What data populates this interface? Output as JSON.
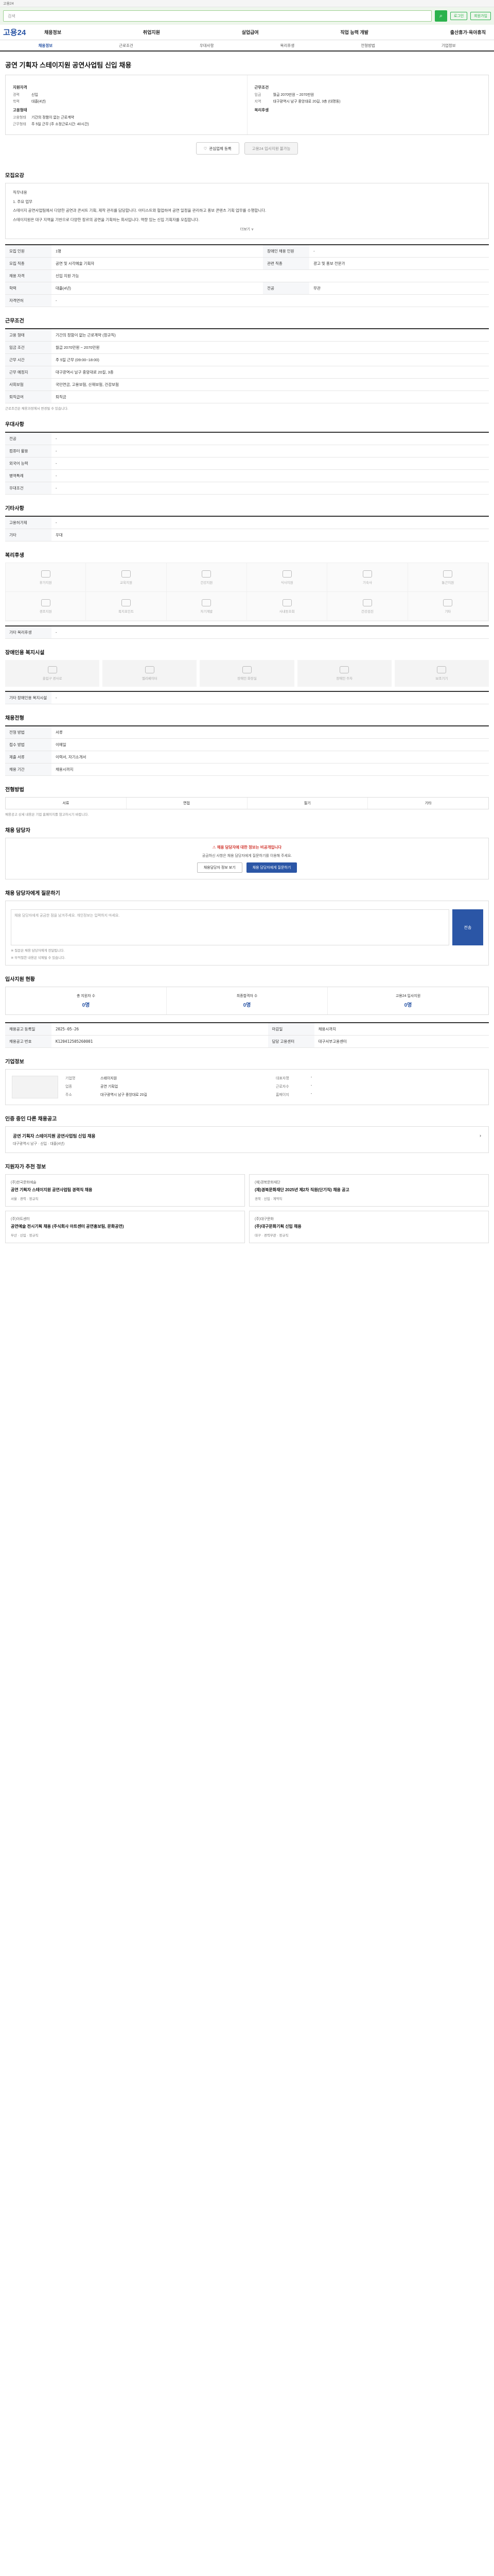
{
  "top": {
    "notice": "고용24",
    "search_placeholder": "검색",
    "login": "로그인",
    "join": "회원가입"
  },
  "gnb": {
    "logo": "고용24",
    "menu": [
      "채용정보",
      "취업지원",
      "실업급여",
      "직업 능력 개발",
      "출산휴가·육아휴직"
    ]
  },
  "tabs": [
    "채용정보",
    "근로조건",
    "우대사항",
    "복리후생",
    "전형방법",
    "기업정보"
  ],
  "job": {
    "title": "공연 기획자 스테이지원 공연사업팀 신입 채용",
    "summary_left_label": "지원자격",
    "summary_right_label": "근무조건",
    "career_k": "경력",
    "career_v": "신입",
    "edu_k": "학력",
    "edu_v": "대졸(4년)",
    "emp_label": "고용형태",
    "emp_k": "고용형태",
    "emp_v": "기간의 정함이 없는 근로계약",
    "hours_k": "근무형태",
    "hours_v": "주 5일 근무 (주 소정근로시간: 40시간)",
    "pay_k": "임금",
    "pay_v": "월급 2070만원 ~ 2070만원",
    "area_k": "지역",
    "area_v": "대구광역시 남구 중앙대로 20길, 3층 (대명동)",
    "welfare_label": "복리후생"
  },
  "buttons": {
    "interest": "관심업체 등록",
    "apply": "고용24 입사지원 불가능"
  },
  "sections": {
    "recruit": "모집요강",
    "conditions": "근무조건",
    "preference": "우대사항",
    "extra": "기타사항",
    "welfare": "복리후생",
    "facility": "장애인용 복지시설",
    "process": "채용전형",
    "apply_method": "전형방법",
    "contact": "채용 담당자",
    "qa": "채용 담당자에게 질문하기",
    "status": "입사지원 현황",
    "company": "기업정보",
    "same_company": "인증 중인 다른 채용공고",
    "recommend": "지원자가 추천 정보"
  },
  "recruit_box": {
    "p1": "직무내용",
    "p2": "1. 주요 업무",
    "p3": "스테이지 공연사업팀에서 다양한 공연과 콘서트 기획, 제작 관리를 담당합니다. 아티스트와 협업하여 공연 일정을 관리하고 홍보 콘텐츠 기획 업무를 수행합니다.",
    "p4": "스테이지원은 대구 지역을 기반으로 다양한 장르의 공연을 기획하는 회사입니다. 역량 있는 신입 기획자를 모집합니다.",
    "more": "더보기 ∨"
  },
  "recruit_table": [
    {
      "k": "모집 인원",
      "v": "1명",
      "k2": "장애인 채용 인원",
      "v2": "-"
    },
    {
      "k": "모집 직종",
      "v": "공연 및 시각예술 기획자",
      "k2": "관련 직종",
      "v2": "광고 및 홍보 전문가"
    },
    {
      "k": "채용 자격",
      "v": "신입 지원 가능",
      "k2": "",
      "v2": ""
    },
    {
      "k": "학력",
      "v": "대졸(4년)",
      "k2": "전공",
      "v2": "무관"
    },
    {
      "k": "자격면허",
      "v": "-",
      "k2": "",
      "v2": ""
    }
  ],
  "cond_table": [
    {
      "k": "고용 형태",
      "v": "기간의 정함이 없는 근로계약 (정규직)"
    },
    {
      "k": "임금 조건",
      "v": "월급 2070만원 ~ 2070만원"
    },
    {
      "k": "근무 시간",
      "v": "주 5일 근무 (09:00~18:00)"
    },
    {
      "k": "근무 예정지",
      "v": "대구광역시 남구 중앙대로 20길, 3층"
    },
    {
      "k": "사회보험",
      "v": "국민연금, 고용보험, 산재보험, 건강보험"
    },
    {
      "k": "퇴직급여",
      "v": "퇴직금"
    }
  ],
  "cond_note": "근로조건은 채용과정에서 변경될 수 있습니다.",
  "pref_table": [
    {
      "k": "전공",
      "v": "-"
    },
    {
      "k": "컴퓨터 활용",
      "v": "-"
    },
    {
      "k": "외국어 능력",
      "v": "-"
    },
    {
      "k": "병역특례",
      "v": "-"
    },
    {
      "k": "우대조건",
      "v": "-"
    }
  ],
  "extra_table": [
    {
      "k": "고용허가제",
      "v": "-"
    },
    {
      "k": "기타",
      "v": "우대"
    }
  ],
  "welfare_items": [
    "휴가지원",
    "교육지원",
    "건강지원",
    "식사지원",
    "기숙사",
    "통근지원",
    "경조지원",
    "복지포인트",
    "자기계발",
    "사내동호회",
    "건강검진",
    "기타"
  ],
  "welfare_note": "기타 복리후생",
  "facility_items": [
    "출입구 경사로",
    "엘리베이터",
    "장애인 화장실",
    "장애인 주차",
    "보조기기"
  ],
  "facility_note": "기타 장애인용 복지시설",
  "process_table": [
    {
      "k": "전형 방법",
      "v": "서류"
    },
    {
      "k": "접수 방법",
      "v": "이메일"
    },
    {
      "k": "제출 서류",
      "v": "이력서, 자기소개서"
    },
    {
      "k": "채용 기간",
      "v": "채용시까지"
    }
  ],
  "apply_methods": [
    "서류",
    "면접",
    "필기",
    "기타"
  ],
  "apply_note": "채용공고 상세 내용은 기업 홈페이지를 참고하시기 바랍니다.",
  "contact": {
    "warn": "채용 담당자에 대한 정보는 비공개입니다",
    "sub": "궁금하신 사항은 채용 담당자에게 질문하기를 이용해 주세요.",
    "btn1": "채용담당자 정보 보기",
    "btn2": "채용 담당자에게 질문하기"
  },
  "qa": {
    "placeholder": "채용 담당자에게 궁금한 점을 남겨주세요. 개인정보는 입력하지 마세요.",
    "send": "전송",
    "note1": "※ 질문은 채용 담당자에게 전달됩니다.",
    "note2": "※ 부적절한 내용은 삭제될 수 있습니다."
  },
  "status": [
    {
      "label": "총 지원자 수",
      "num": "0명"
    },
    {
      "label": "최종합격자 수",
      "num": "0명"
    },
    {
      "label": "고용24 입사지원",
      "num": "0명"
    }
  ],
  "dates": [
    {
      "k": "채용공고 등록일",
      "v": "2025-05-26",
      "k2": "마감일",
      "v2": "채용시까지"
    },
    {
      "k": "채용공고 번호",
      "v": "K120412505260001",
      "k2": "담당 고용센터",
      "v2": "대구서부고용센터"
    }
  ],
  "company": {
    "name_k": "기업명",
    "name_v": "스테이지원",
    "ceo_k": "대표자명",
    "ceo_v": "-",
    "industry_k": "업종",
    "industry_v": "공연 기획업",
    "size_k": "근로자수",
    "size_v": "-",
    "addr_k": "주소",
    "addr_v": "대구광역시 남구 중앙대로 20길",
    "home_k": "홈페이지",
    "home_v": "-"
  },
  "same_job": {
    "title": "공연 기획자 스테이지원 공연사업팀 신입 채용",
    "sub": "대구광역시 남구 · 신입 · 대졸(4년)"
  },
  "recs": [
    {
      "company": "(주)한국문화예술",
      "title": "공연 기획자 스테이지원 공연사업팀 경력직 채용",
      "meta": "서울 · 경력 · 정규직"
    },
    {
      "company": "(재)경북문화재단",
      "title": "(재)경북문화재단 2025년 제2차 직원(단기직) 채용 공고",
      "meta": "경북 · 신입 · 계약직"
    },
    {
      "company": "(주)아트센터",
      "title": "공연예술 전시기획 채용 (주식회사 아트센터 공연홍보팀, 문화공연)",
      "meta": "부산 · 신입 · 정규직"
    },
    {
      "company": "(주)대구문화",
      "title": "(주)대구문화기획 신입 채용",
      "meta": "대구 · 경력무관 · 정규직"
    }
  ]
}
